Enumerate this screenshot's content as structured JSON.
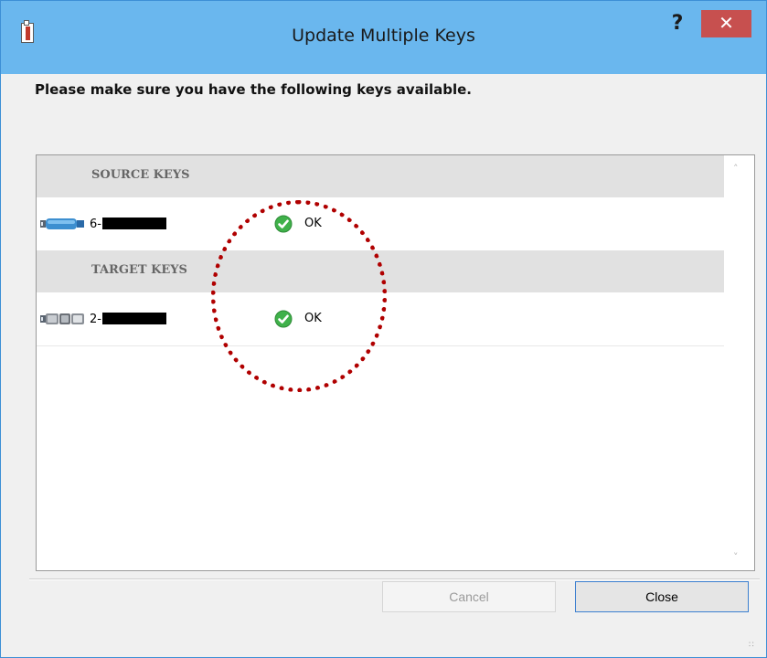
{
  "window": {
    "title": "Update Multiple Keys",
    "help_label": "?",
    "close_label": "✕"
  },
  "instruction": "Please make sure you have the following keys available.",
  "sections": [
    {
      "header": "SOURCE KEYS",
      "keys": [
        {
          "id_prefix": "6-",
          "id_redacted": true,
          "status": "OK",
          "icon": "usb-key-blue-icon"
        }
      ]
    },
    {
      "header": "TARGET KEYS",
      "keys": [
        {
          "id_prefix": "2-",
          "id_redacted": true,
          "status": "OK",
          "icon": "usb-key-gray-icon"
        }
      ]
    }
  ],
  "status_icon": "green-check-icon",
  "buttons": {
    "cancel": "Cancel",
    "close": "Close",
    "cancel_enabled": false
  },
  "colors": {
    "titlebar": "#6ab7ee",
    "close_button": "#c7504f",
    "section_header_bg": "#e1e1e1",
    "ok_green": "#4caf50",
    "highlight": "#b00000"
  }
}
